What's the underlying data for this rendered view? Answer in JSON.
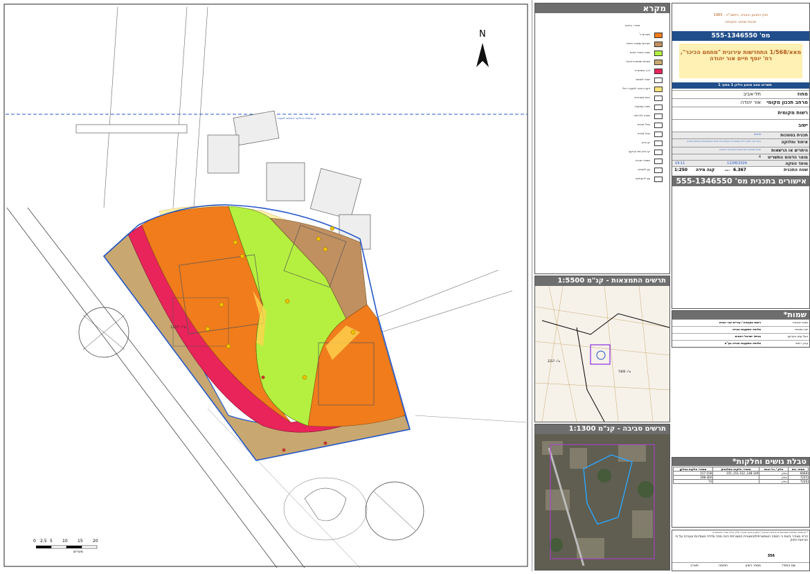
{
  "map": {
    "north_label": "N",
    "scale_ticks": [
      "0",
      "2.5",
      "5",
      "10",
      "15",
      "20"
    ],
    "scale_unit": "מטרים",
    "parcel_area_west": "1217 מ\"ר",
    "neighbour_label": "ק. השטח בחלקה הגושים לשעבר",
    "colors": {
      "residential": "#f07c1c",
      "residential_special": "#c09061",
      "open_space": "#b5f040",
      "road": "#e8245a",
      "agri": "#c8a870",
      "blue_line": "#2456c8"
    }
  },
  "legend": {
    "title": "מקרא",
    "items": [
      {
        "label": "מגורים ד'",
        "color": "#f07c1c"
      },
      {
        "label": "מגורים ומסחר מיוחד",
        "color": "#c09061"
      },
      {
        "label": "שטח ציבורי פתוח",
        "color": "#b5f040"
      },
      {
        "label": "מבנים ומוסדות ציבור",
        "color": "#c8a870"
      },
      {
        "label": "דרך מאושרת",
        "color": "#e8245a"
      },
      {
        "label": "שטח לשימור",
        "color": "#ffffff"
      },
      {
        "label": "זיקת הנאה למעבר רגלי",
        "color": "#ffe27a"
      },
      {
        "label": "חזית מסחרית",
        "color": "#ffffff"
      },
      {
        "label": "שטח עתיקות",
        "color": "#ffffff"
      },
      {
        "label": "מבנה להריסה",
        "color": "#ffffff"
      },
      {
        "label": "גבול תכנית",
        "color": "#ffffff"
      },
      {
        "label": "גבול מגרש",
        "color": "#ffffff"
      },
      {
        "label": "קו בניין",
        "color": "#ffffff"
      },
      {
        "label": "קו בניין תת קרקעי",
        "color": "#ffffff"
      },
      {
        "label": "מספר מגרש",
        "color": "#ffffff"
      },
      {
        "label": "עץ לשימור",
        "color": "#ffffff"
      },
      {
        "label": "עץ להעתקה",
        "color": "#ffffff"
      }
    ],
    "header_small": "משרד הפנים"
  },
  "insets": {
    "location_title": "תרשים התמצאות - קנ\"מ 1:5500",
    "surroundings_title": "תרשים סביבה - קנ\"מ 1:1300",
    "location_area_a": "2217 מ\"ר",
    "location_area_b": "7400 מ\"ר"
  },
  "titleblock": {
    "law": "חוק התכנון והבניה, התשכ\"ה - 1965",
    "plan_type": "תכנית מתאר מקומית",
    "plan_number": "מס' 555-1346550",
    "plan_name": "מאא/1/568 התחדשות עירונית \"מתחם הכיכר\", רח' יוסף חיים אור יהודה",
    "sheet_label": "גיליון 1 מתוך 1",
    "sheet_label_b": "תשריט מצב מוצע",
    "rows": [
      {
        "label": "מחוז",
        "value": "תל-אביב"
      },
      {
        "label": "מרחב תכנון מקומי",
        "value": "אור יהודה"
      },
      {
        "label": "רשות מקומית",
        "value": ""
      },
      {
        "label": "ישוב",
        "value": ""
      }
    ],
    "fields": [
      {
        "label": "תכנית בסמכות",
        "value": "מחוזית"
      },
      {
        "label": "איחוד וחלוקה",
        "value": "איחוד ו/או חלוקה ללא הסכמת כל הבעלים בכל תחום התכנית/בחלק מתחום התכנית"
      },
      {
        "label": "היתרים או הרשאות",
        "value": "תכנית שמכוחה ניתן להוציא היתרים או הרשאות"
      },
      {
        "label": "מוצר הדפוס התשריט",
        "value": "4"
      },
      {
        "label": "מועד הפקה",
        "value": "11/08/2024"
      },
      {
        "label": "שעה",
        "value": "19:11"
      }
    ],
    "area_label": "שטח התכנית",
    "area_value": "6.367",
    "area_unit": "דונם",
    "scale_label": "קנה מידה",
    "scale_value": "1:250",
    "approvals_title": "אישורים בתכנית מס' 555-1346550"
  },
  "names": {
    "title": "שמות*",
    "rows": [
      {
        "role": "מגיש התכנית",
        "name": "רשות מקומית / עיריית אור יהודה"
      },
      {
        "role": "יזם התכנית",
        "name": "סלופה השקעות ובנייה"
      },
      {
        "role": "בעל עניין בקרקע",
        "name": "מגיש: ישראל רחמים"
      },
      {
        "role": "עורך ראשי",
        "name": "סלופה השקעות ובנייה בע\"מ"
      }
    ]
  },
  "parcels": {
    "title": "טבלת גושים וחלקות*",
    "headers": [
      "מספר גוש",
      "חלק / כל הגוש",
      "מספרי חלקות בשלמותן",
      "מספרי חלקות בחלקן"
    ],
    "rows": [
      [
        "6668",
        "חלק",
        "148-149, 151-152, 155",
        "157-158"
      ],
      [
        "7225",
        "חלק",
        "",
        "298-300"
      ],
      [
        "7226",
        "חלק",
        "",
        "74"
      ]
    ]
  },
  "signature": {
    "note": "* הנתונים המלאים מופיעים בהוראות התכנית / בתקנון אשר מהווה חלק בלתי נפרד מהתשריט",
    "statement": "הריני מצהיר בזאת כי המפה הטופוגרפית/המצבית המצורפת הינה מפה מדידה מעודכנת ונערכה על פי הוראות החוק",
    "surveyor_label": "שם המודד",
    "license_label": "מספר רשיון",
    "license_value": "356",
    "signature_label": "חתימה",
    "date_label": "תאריך"
  }
}
